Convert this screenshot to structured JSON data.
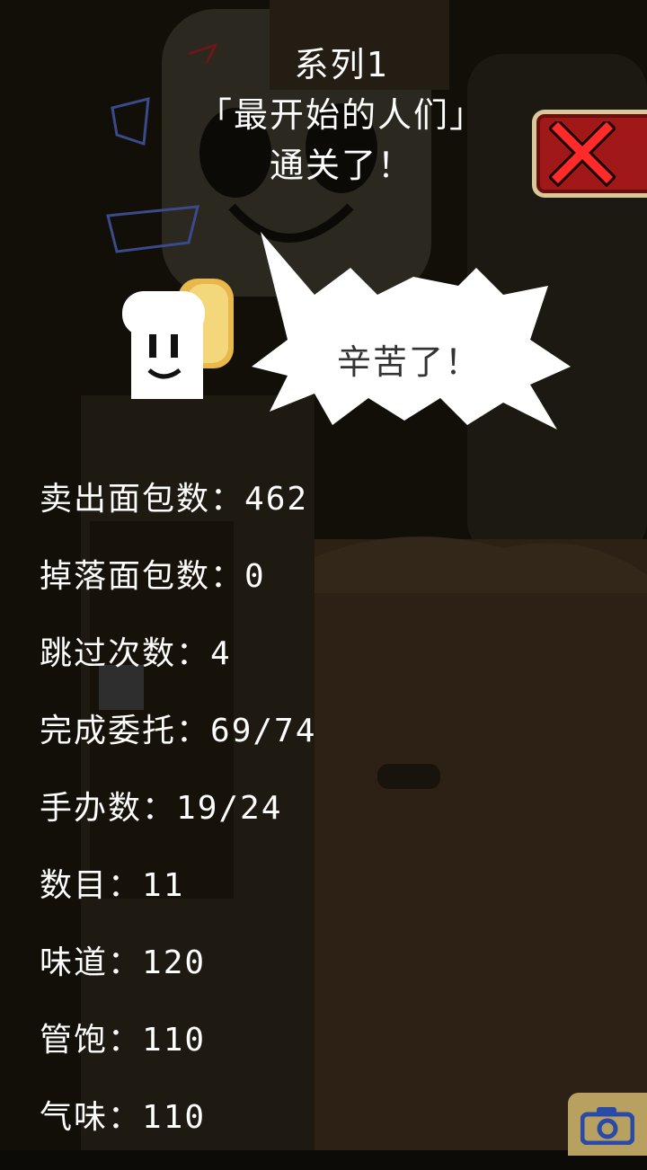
{
  "title": {
    "line1": "系列1",
    "line2": "「最开始的人们」",
    "line3": "通关了！"
  },
  "bubble": {
    "text": "辛苦了！"
  },
  "stats": [
    {
      "label": "卖出面包数",
      "value": "462"
    },
    {
      "label": "掉落面包数",
      "value": "0"
    },
    {
      "label": "跳过次数",
      "value": "4"
    },
    {
      "label": "完成委托",
      "value": "69/74"
    },
    {
      "label": "手办数",
      "value": "19/24"
    },
    {
      "label": "数目",
      "value": "11"
    },
    {
      "label": "味道",
      "value": "120"
    },
    {
      "label": "管饱",
      "value": "110"
    },
    {
      "label": "气味",
      "value": "110"
    }
  ],
  "separator": "：",
  "icons": {
    "close": "close-x-icon",
    "camera": "camera-icon",
    "mascot": "toast-bread-mascot"
  },
  "colors": {
    "close_bg": "#a01818",
    "close_x": "#ff2a2a",
    "camera_bg": "#b8a060",
    "camera_icon": "#2a4aa8",
    "bubble": "#ffffff"
  }
}
